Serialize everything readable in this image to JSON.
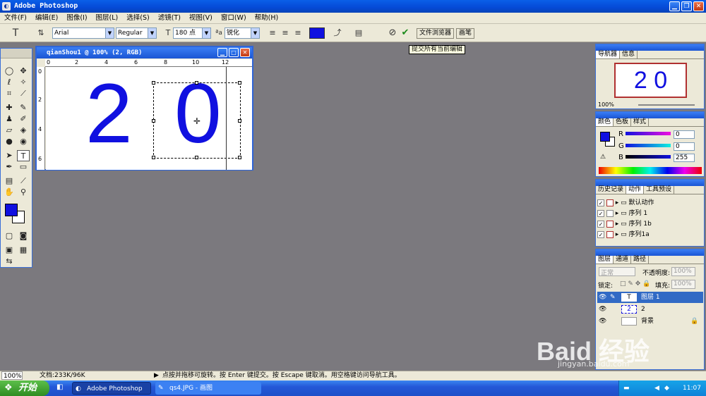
{
  "window": {
    "title": "Adobe Photoshop"
  },
  "menu": [
    "文件(F)",
    "编辑(E)",
    "图像(I)",
    "图层(L)",
    "选择(S)",
    "滤镜(T)",
    "视图(V)",
    "窗口(W)",
    "帮助(H)"
  ],
  "options": {
    "font_family": "Arial",
    "font_style": "Regular",
    "font_size": "180 点",
    "antialias": "锐化",
    "text_color": "#1010e0",
    "tab_file_browser": "文件浏览器",
    "tab_brushes": "画笔",
    "tooltip": "提交所有当前编辑"
  },
  "document": {
    "title": "qianShou1 @ 100% (2, RGB)",
    "ruler_h_ticks": [
      "0",
      "2",
      "4",
      "6",
      "8",
      "10",
      "12"
    ],
    "ruler_v_ticks": [
      "0",
      "2",
      "4",
      "6"
    ],
    "digit_left": "2",
    "digit_right": "0"
  },
  "navigator": {
    "tabs": [
      "导航器",
      "信息"
    ],
    "preview_text": "2 0",
    "zoom": "100%"
  },
  "color_panel": {
    "tabs": [
      "颜色",
      "色板",
      "样式"
    ],
    "r_label": "R",
    "g_label": "G",
    "b_label": "B",
    "r_value": "0",
    "g_value": "0",
    "b_value": "255",
    "foreground": "#1010e0"
  },
  "actions_panel": {
    "tabs": [
      "历史记录",
      "动作",
      "工具预设"
    ],
    "items": [
      "默认动作",
      "序列 1",
      "序列 1b",
      "序列1a"
    ]
  },
  "layers_panel": {
    "tabs": [
      "图层",
      "通道",
      "路径"
    ],
    "blend_mode": "正常",
    "opacity_label": "不透明度:",
    "opacity": "100%",
    "lock_label": "锁定:",
    "fill_label": "填充:",
    "fill": "100%",
    "layers": [
      {
        "name": "图层 1",
        "thumb": "T",
        "selected": true
      },
      {
        "name": "2",
        "thumb": "2",
        "selected": false
      },
      {
        "name": "背景",
        "thumb": "",
        "selected": false
      }
    ]
  },
  "statusbar": {
    "zoom": "100%",
    "doc_size": "文档:233K/96K",
    "hint": "点按并拖移可旋转。按 Enter 键提交。按 Escape 键取消。用空格键访问导航工具。"
  },
  "taskbar": {
    "start": "开始",
    "tasks": [
      "Adobe Photoshop",
      "qs4.JPG - 画图"
    ],
    "clock": "11:07"
  },
  "watermark": {
    "brand": "Baid 经验",
    "url": "jingyan.baidu.com"
  }
}
